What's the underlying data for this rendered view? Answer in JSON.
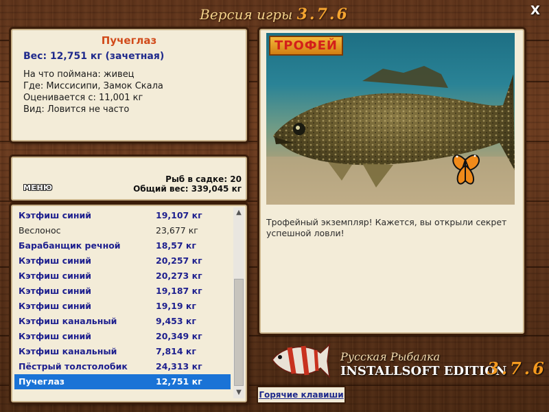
{
  "header": {
    "title": "Версия игры",
    "version": "3.7.6",
    "close_label": "X"
  },
  "catch_info": {
    "fish_name": "Пучеглаз",
    "weight": "Вес: 12,751 кг (зачетная)",
    "caught_on": "На что поймана: живец",
    "location": "Где: Миссисипи, Замок Скала",
    "rated_from": "Оценивается с: 11,001 кг",
    "type": "Вид: Ловится не часто"
  },
  "stats": {
    "menu_label": "МЕНЮ",
    "fish_in_keepnet": "Рыб в садке: 20",
    "total_weight": "Общий вес: 339,045 кг"
  },
  "catch_list": [
    {
      "name": "Кэтфиш синий",
      "weight": "19,107 кг",
      "style": "hi"
    },
    {
      "name": "Веслонос",
      "weight": "23,677 кг",
      "style": "lo"
    },
    {
      "name": "Барабанщик речной",
      "weight": "18,57 кг",
      "style": "hi"
    },
    {
      "name": "Кэтфиш синий",
      "weight": "20,257 кг",
      "style": "hi"
    },
    {
      "name": "Кэтфиш синий",
      "weight": "20,273 кг",
      "style": "hi"
    },
    {
      "name": "Кэтфиш синий",
      "weight": "19,187 кг",
      "style": "hi"
    },
    {
      "name": "Кэтфиш синий",
      "weight": "19,19 кг",
      "style": "hi"
    },
    {
      "name": "Кэтфиш канальный",
      "weight": "9,453 кг",
      "style": "hi"
    },
    {
      "name": "Кэтфиш синий",
      "weight": "20,349 кг",
      "style": "hi"
    },
    {
      "name": "Кэтфиш канальный",
      "weight": "7,814 кг",
      "style": "hi"
    },
    {
      "name": "Пёстрый толстолобик",
      "weight": "24,313 кг",
      "style": "hi"
    },
    {
      "name": "Пучеглаз",
      "weight": "12,751 кг",
      "style": "sel"
    }
  ],
  "trophy": {
    "badge": "ТРОФЕЙ",
    "description": "Трофейный экземпляр! Кажется, вы открыли секрет успешной ловли!"
  },
  "branding": {
    "line1": "Русская Рыбалка",
    "line2": "INSTALLSOFT EDITION",
    "version": "3.7.6"
  },
  "hotkeys_label": "Горячие клавиши"
}
